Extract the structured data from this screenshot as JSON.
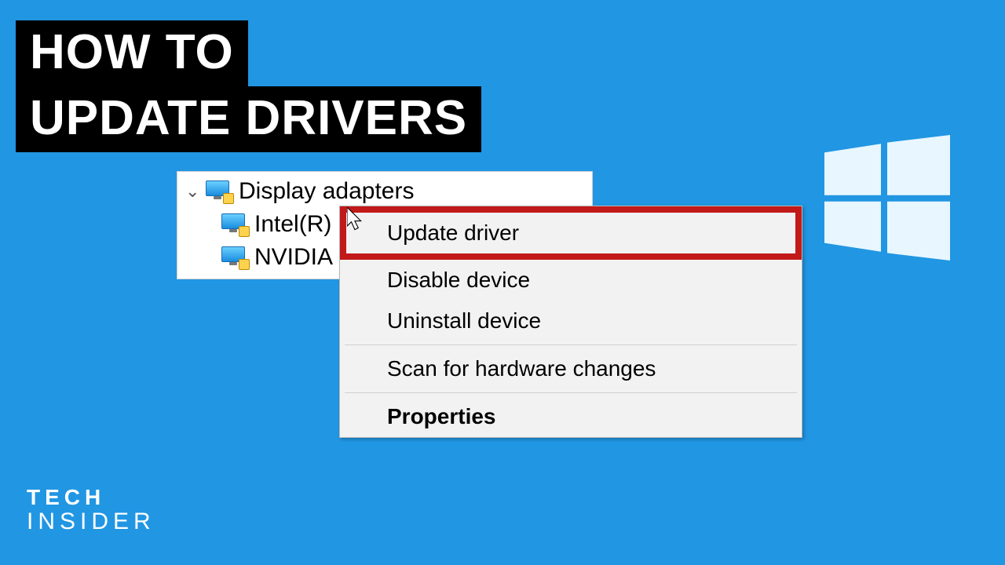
{
  "title": {
    "line1": "HOW TO",
    "line2": "UPDATE DRIVERS"
  },
  "device_tree": {
    "category": "Display adapters",
    "items": [
      {
        "label": "Intel(R)"
      },
      {
        "label": "NVIDIA"
      }
    ]
  },
  "context_menu": {
    "items": [
      {
        "label": "Update driver",
        "highlighted": true
      },
      {
        "label": "Disable device"
      },
      {
        "label": "Uninstall device"
      }
    ],
    "items2": [
      {
        "label": "Scan for hardware changes"
      }
    ],
    "items3": [
      {
        "label": "Properties",
        "bold": true
      }
    ]
  },
  "brand": {
    "line1": "TECH",
    "line2": "INSIDER"
  }
}
